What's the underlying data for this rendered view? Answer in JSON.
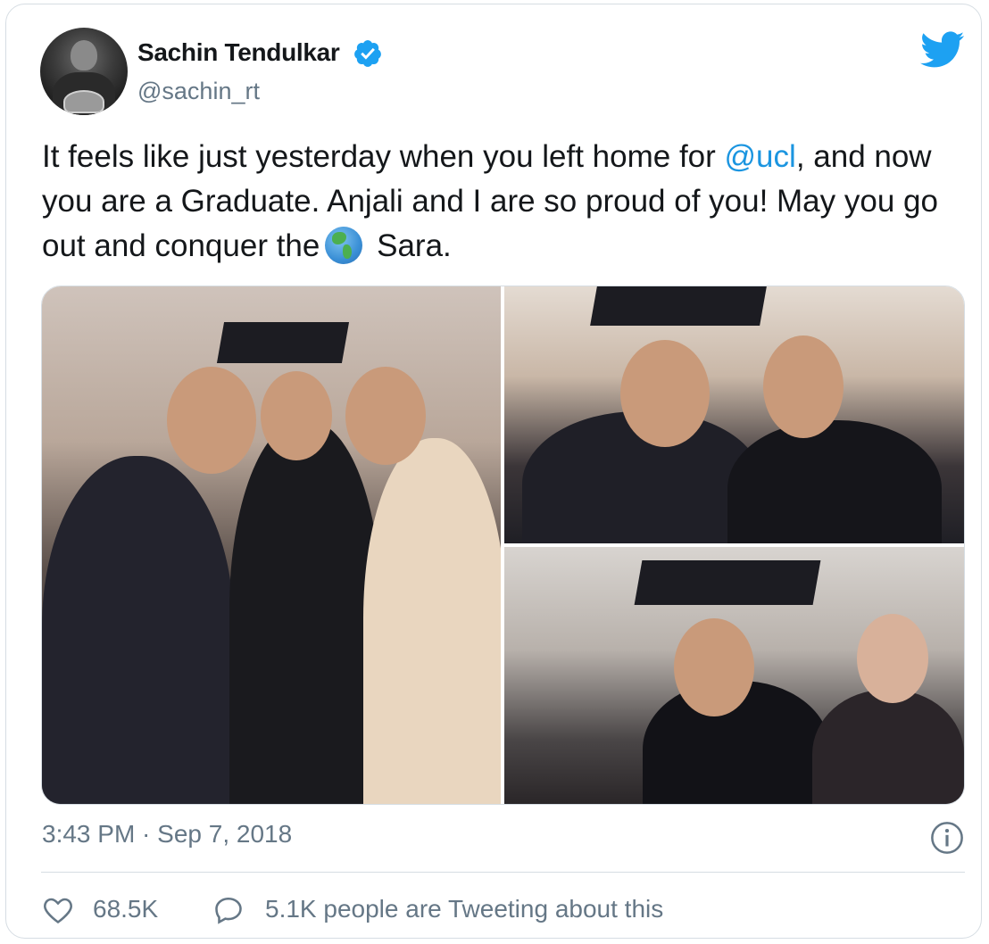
{
  "author": {
    "name": "Sachin Tendulkar",
    "handle": "@sachin_rt",
    "verified": true
  },
  "tweet": {
    "text_part1": "It feels like just yesterday when you left home for ",
    "mention": "@ucl",
    "text_part2": ", and now you are a Graduate. Anjali and I are so proud of you! May you go out and conquer the",
    "emoji": "globe-americas-icon",
    "text_part3": " Sara."
  },
  "media": {
    "photos": [
      {
        "alt": "family-graduation-photo"
      },
      {
        "alt": "father-daughter-photo"
      },
      {
        "alt": "graduate-portrait-photo"
      }
    ]
  },
  "meta": {
    "timestamp": "3:43 PM · Sep 7, 2018"
  },
  "actions": {
    "like_count": "68.5K",
    "reply_text": "5.1K people are Tweeting about this"
  },
  "colors": {
    "link": "#1b95e0",
    "secondary_text": "#657786",
    "twitter_blue": "#1da1f2",
    "border": "#d6dde3"
  }
}
